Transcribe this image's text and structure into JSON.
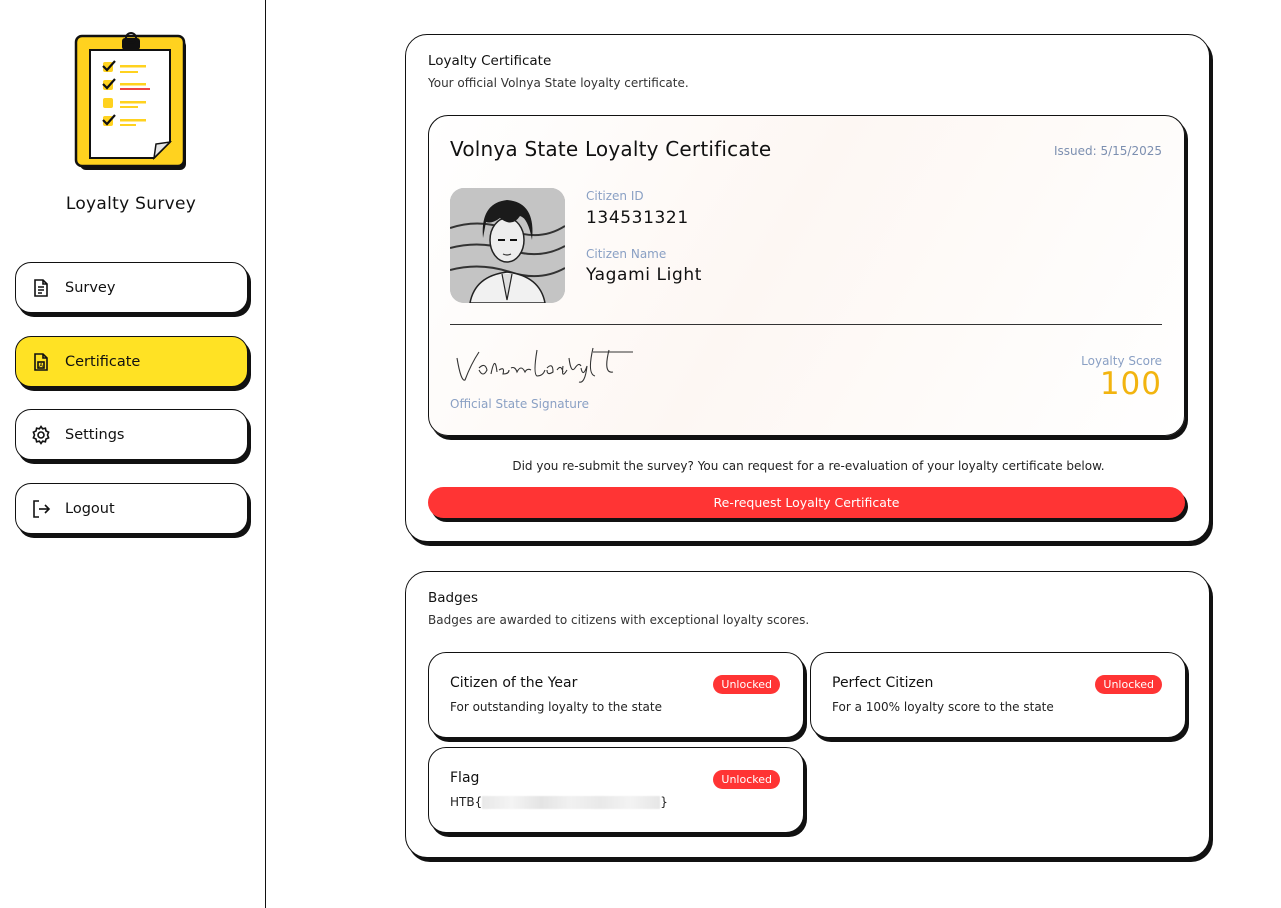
{
  "sidebar": {
    "app_title": "Loyalty Survey",
    "items": [
      {
        "label": "Survey",
        "icon": "document-icon",
        "active": false
      },
      {
        "label": "Certificate",
        "icon": "certificate-icon",
        "active": true
      },
      {
        "label": "Settings",
        "icon": "gear-icon",
        "active": false
      },
      {
        "label": "Logout",
        "icon": "logout-icon",
        "active": false
      }
    ]
  },
  "certificate_section": {
    "title": "Loyalty Certificate",
    "subtitle": "Your official Volnya State loyalty certificate.",
    "certificate": {
      "title": "Volnya State Loyalty Certificate",
      "issued": "Issued: 5/15/2025",
      "citizen_id_label": "Citizen ID",
      "citizen_id": "134531321",
      "citizen_name_label": "Citizen Name",
      "citizen_name": "Yagami Light",
      "signature_label": "Official State Signature",
      "score_label": "Loyalty Score",
      "score": "100"
    },
    "resubmit_note": "Did you re-submit the survey? You can request for a re-evaluation of your loyalty certificate below.",
    "rerequest_button": "Re-request Loyalty Certificate"
  },
  "badges_section": {
    "title": "Badges",
    "subtitle": "Badges are awarded to citizens with exceptional loyalty scores.",
    "badges": [
      {
        "title": "Citizen of the Year",
        "description": "For outstanding loyalty to the state",
        "status": "Unlocked"
      },
      {
        "title": "Perfect Citizen",
        "description": "For a 100% loyalty score to the state",
        "status": "Unlocked"
      },
      {
        "title": "Flag",
        "description_prefix": "HTB{",
        "description_suffix": "}",
        "status": "Unlocked"
      }
    ]
  },
  "colors": {
    "accent_yellow": "#ffe224",
    "danger_red": "#ff3434",
    "score_gold": "#f2b40f",
    "label_blue": "#8aa0c4"
  }
}
